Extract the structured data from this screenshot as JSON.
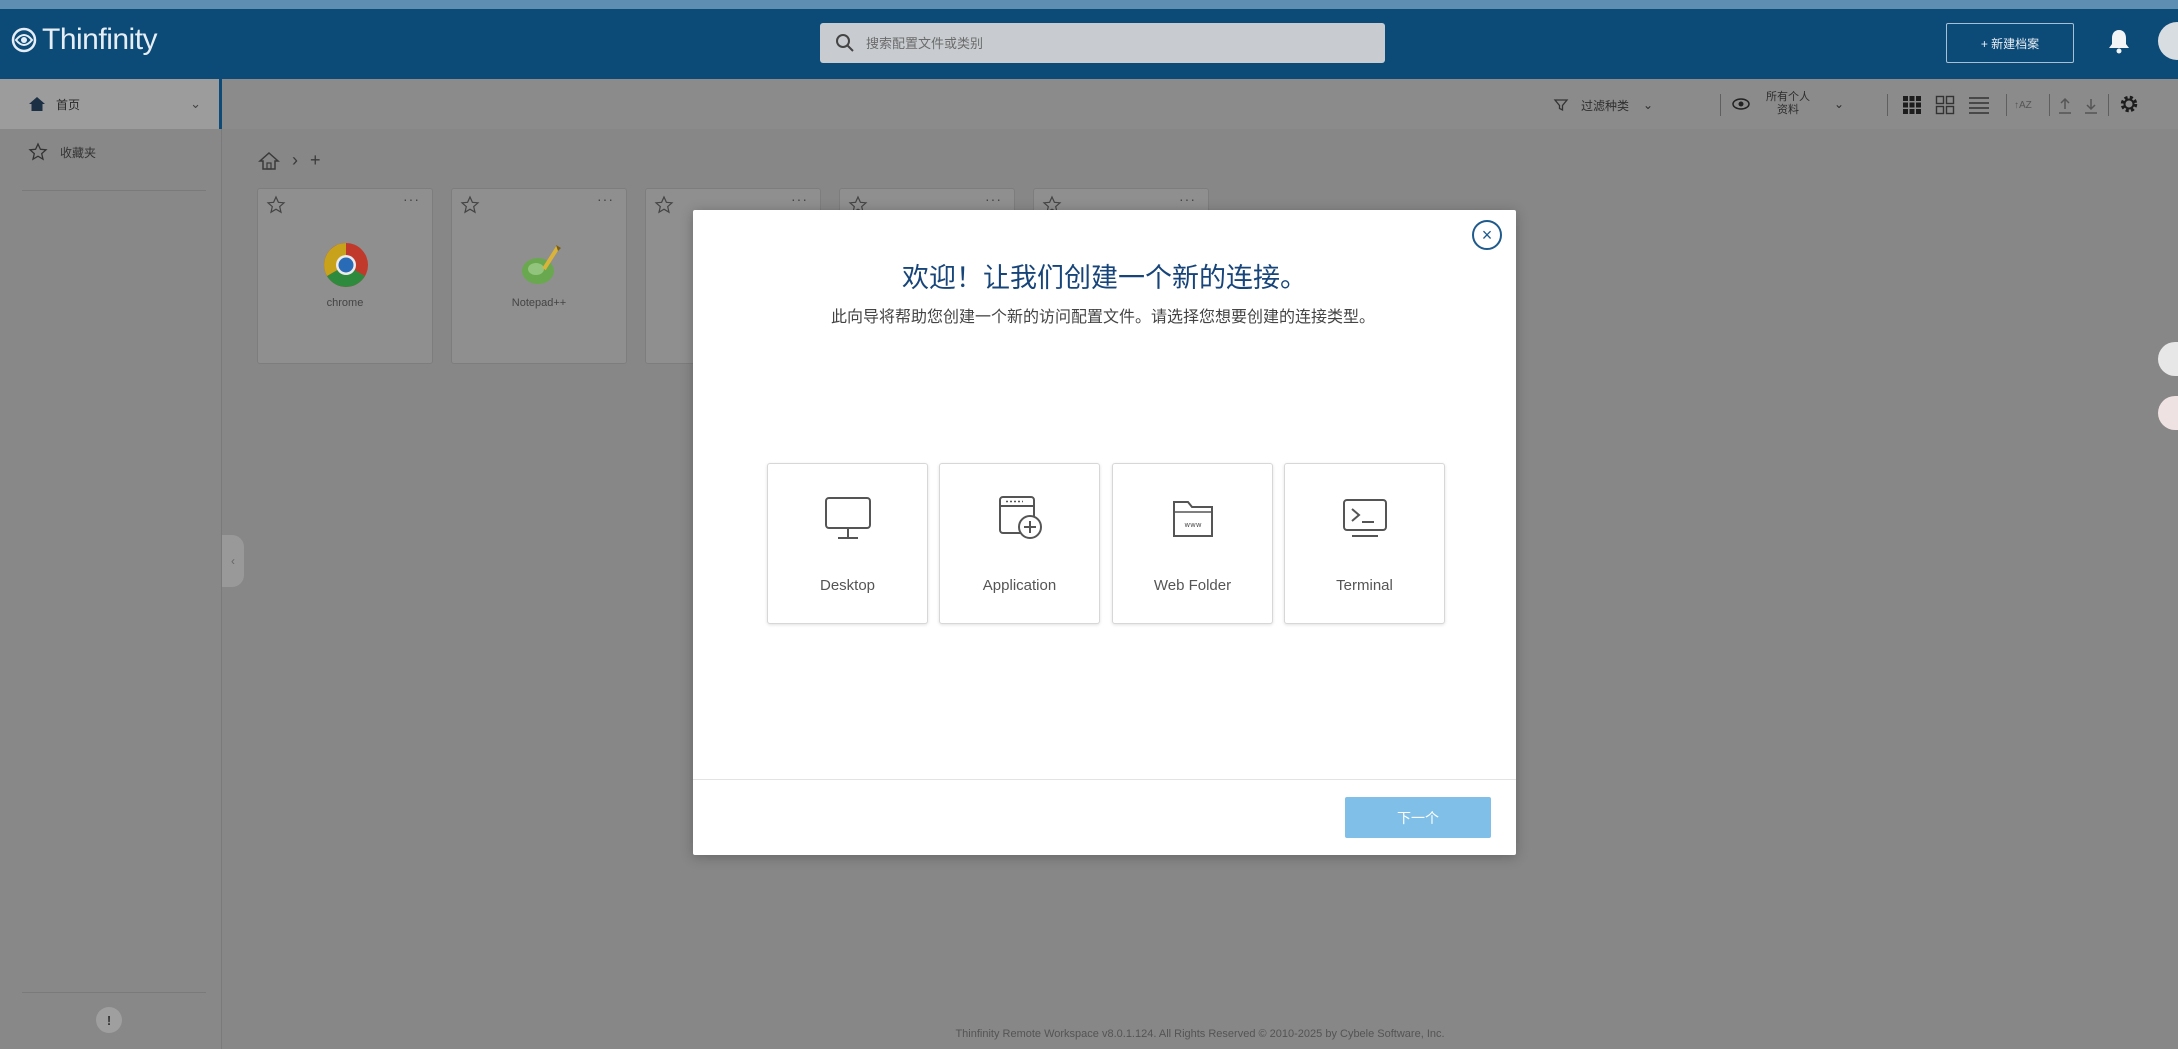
{
  "app": {
    "brand": "Thinfinity"
  },
  "header": {
    "search_placeholder": "搜索配置文件或类别",
    "new_button_label": "+ 新建档案"
  },
  "sidebar": {
    "home_label": "首页",
    "favorites_label": "收藏夹"
  },
  "toolbar": {
    "filter_label": "过滤种类",
    "visibility_label": "所有个人资料",
    "sort_label": "↑AZ"
  },
  "breadcrumb": {
    "add_symbol": "+"
  },
  "cards": [
    {
      "name": "chrome",
      "icon": "chrome-icon"
    },
    {
      "name": "Notepad++",
      "icon": "notepad-plus-plus-icon"
    },
    {
      "name": "",
      "icon": ""
    },
    {
      "name": "",
      "icon": ""
    },
    {
      "name": "",
      "icon": ""
    }
  ],
  "card_more_symbol": "···",
  "modal": {
    "title": "欢迎！让我们创建一个新的连接。",
    "subtitle": "此向导将帮助您创建一个新的访问配置文件。请选择您想要创建的连接类型。",
    "options": [
      {
        "label": "Desktop",
        "icon": "monitor-icon"
      },
      {
        "label": "Application",
        "icon": "application-window-icon"
      },
      {
        "label": "Web Folder",
        "icon": "web-folder-icon"
      },
      {
        "label": "Terminal",
        "icon": "terminal-icon"
      }
    ],
    "next_button_label": "下一个"
  },
  "footer": {
    "text": "Thinfinity Remote Workspace v8.0.1.124. All Rights Reserved © 2010-2025 by Cybele Software, Inc."
  },
  "colors": {
    "header_bg": "#0c4a78",
    "overlay_bg": "#878787",
    "title_blue": "#17457a",
    "next_button": "#80c0e8"
  }
}
